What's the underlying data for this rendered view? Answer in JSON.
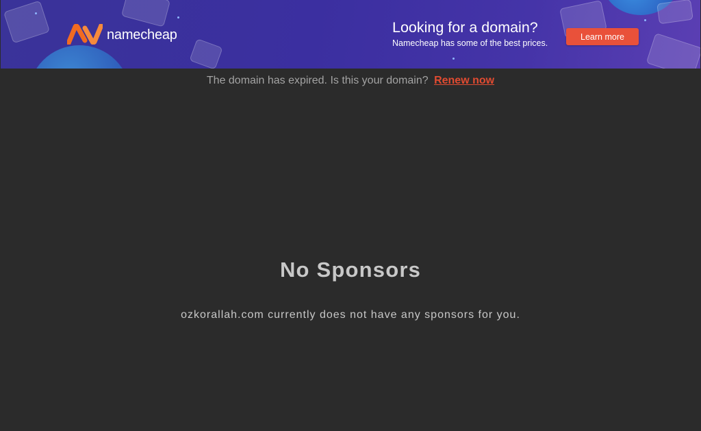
{
  "banner": {
    "logo_text": "namecheap",
    "title": "Looking for a domain?",
    "subtitle": "Namecheap has some of the best prices.",
    "button_label": "Learn more",
    "colors": {
      "background": "#3b2fa0",
      "button": "#e9513a",
      "logo_orange": "#f26b21"
    }
  },
  "notice": {
    "text": "The domain has expired. Is this your domain?",
    "link_label": "Renew now",
    "link_color": "#e14b31"
  },
  "main": {
    "heading": "No Sponsors",
    "description": "ozkorallah.com currently does not have any sponsors for you."
  }
}
